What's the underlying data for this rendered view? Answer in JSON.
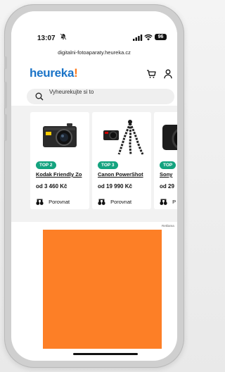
{
  "status_bar": {
    "time": "13:07",
    "battery": "96"
  },
  "browser": {
    "url": "digitalni-fotoaparaty.heureka.cz"
  },
  "header": {
    "logo_text": "heureka",
    "logo_mark": "!",
    "brand_color": "#1a73c7",
    "accent_color": "#ff7a1a"
  },
  "search": {
    "placeholder": "Vyheurekujte si to"
  },
  "products": [
    {
      "badge": "TOP 2",
      "name": "Kodak Friendly Zo",
      "price": "od 3 460 Kč",
      "compare_label": "Porovnat",
      "image_icon": "compact-camera-icon"
    },
    {
      "badge": "TOP 3",
      "name": "Canon PowerShot",
      "price": "od 19 990 Kč",
      "compare_label": "Porovnat",
      "image_icon": "camera-tripod-icon"
    },
    {
      "badge": "TOP",
      "name": "Sony",
      "price": "od 29",
      "compare_label": "P",
      "image_icon": "dslr-camera-icon"
    }
  ],
  "ad": {
    "label": "Reklama",
    "color": "#fd7f26"
  },
  "colors": {
    "badge_green": "#14a37f"
  }
}
